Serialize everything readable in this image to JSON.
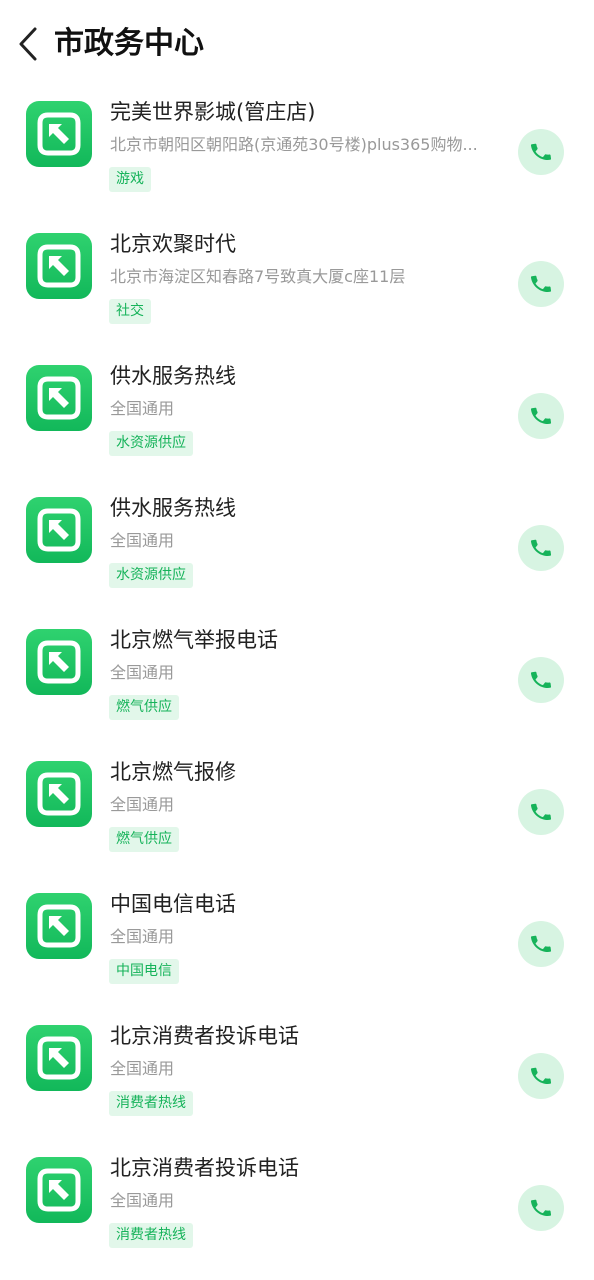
{
  "header": {
    "title": "市政务中心"
  },
  "colors": {
    "accent": "#16b35a",
    "icon_green": "#1fc463",
    "tag_bg": "#e2f7ea",
    "call_bg": "#d7f4e2"
  },
  "items": [
    {
      "title": "完美世界影城(管庄店)",
      "subtitle": "北京市朝阳区朝阳路(京通苑30号楼)plus365购物...",
      "tag": "游戏"
    },
    {
      "title": "北京欢聚时代",
      "subtitle": "北京市海淀区知春路7号致真大厦c座11层",
      "tag": "社交"
    },
    {
      "title": "供水服务热线",
      "subtitle": "全国通用",
      "tag": "水资源供应"
    },
    {
      "title": "供水服务热线",
      "subtitle": "全国通用",
      "tag": "水资源供应"
    },
    {
      "title": "北京燃气举报电话",
      "subtitle": "全国通用",
      "tag": "燃气供应"
    },
    {
      "title": "北京燃气报修",
      "subtitle": "全国通用",
      "tag": "燃气供应"
    },
    {
      "title": "中国电信电话",
      "subtitle": "全国通用",
      "tag": "中国电信"
    },
    {
      "title": "北京消费者投诉电话",
      "subtitle": "全国通用",
      "tag": "消费者热线"
    },
    {
      "title": "北京消费者投诉电话",
      "subtitle": "全国通用",
      "tag": "消费者热线"
    }
  ]
}
